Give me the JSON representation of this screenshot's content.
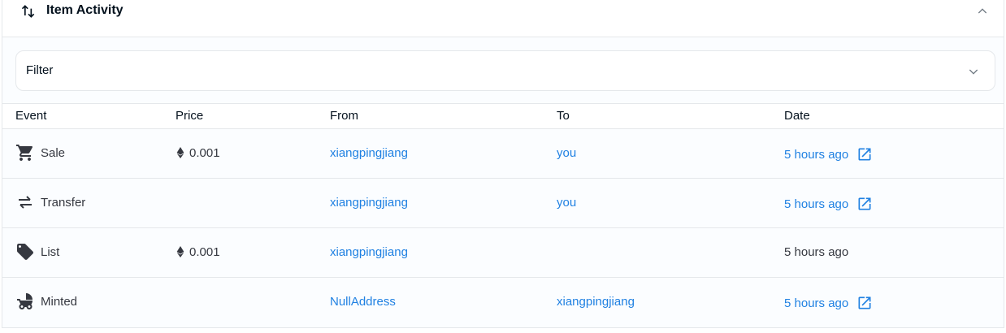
{
  "header": {
    "title": "Item Activity",
    "icon": "swap-vertical-icon",
    "collapse_icon": "chevron-up-icon"
  },
  "filter": {
    "label": "Filter",
    "icon": "chevron-down-icon"
  },
  "table": {
    "columns": [
      "Event",
      "Price",
      "From",
      "To",
      "Date"
    ],
    "rows": [
      {
        "event": "Sale",
        "icon": "cart-icon",
        "price": "0.001",
        "from": "xiangpingjiang",
        "to": "you",
        "date": "5 hours ago",
        "date_link": true
      },
      {
        "event": "Transfer",
        "icon": "transfer-icon",
        "price": "",
        "from": "xiangpingjiang",
        "to": "you",
        "date": "5 hours ago",
        "date_link": true
      },
      {
        "event": "List",
        "icon": "tag-icon",
        "price": "0.001",
        "from": "xiangpingjiang",
        "to": "",
        "date": "5 hours ago",
        "date_link": false
      },
      {
        "event": "Minted",
        "icon": "stroller-icon",
        "price": "",
        "from": "NullAddress",
        "to": "xiangpingjiang",
        "date": "5 hours ago",
        "date_link": true
      }
    ]
  },
  "colors": {
    "link": "#2081e2",
    "text": "#353840",
    "border": "#e5e8eb"
  }
}
